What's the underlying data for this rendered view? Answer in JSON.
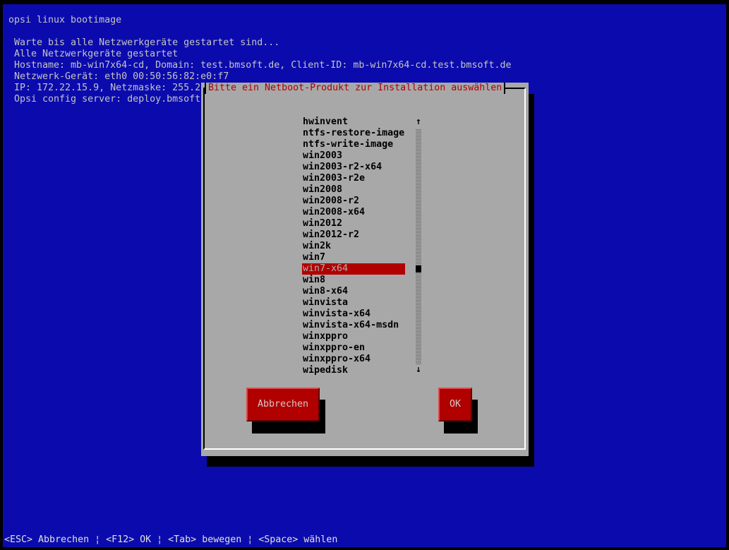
{
  "screen": {
    "title": "opsi linux bootimage",
    "lines": [
      "Warte bis alle Netzwerkgeräte gestartet sind...",
      "Alle Netzwerkgeräte gestartet",
      "Hostname: mb-win7x64-cd, Domain: test.bmsoft.de, Client-ID: mb-win7x64-cd.test.bmsoft.de",
      "Netzwerk-Gerät: eth0 00:50:56:82:e0:f7",
      "IP: 172.22.15.9, Netzmaske: 255.2",
      "Opsi config server: deploy.bmsoft"
    ]
  },
  "dialog": {
    "title": "Bitte ein Netboot-Produkt zur Installation auswählen",
    "items": [
      "hwinvent",
      "ntfs-restore-image",
      "ntfs-write-image",
      "win2003",
      "win2003-r2-x64",
      "win2003-r2e",
      "win2008",
      "win2008-r2",
      "win2008-x64",
      "win2012",
      "win2012-r2",
      "win2k",
      "win7",
      "win7-x64",
      "win8",
      "win8-x64",
      "winvista",
      "winvista-x64",
      "winvista-x64-msdn",
      "winxppro",
      "winxppro-en",
      "winxppro-x64",
      "wipedisk"
    ],
    "selected": "win7-x64",
    "scroll_up": "↑",
    "scroll_down": "↓",
    "cancel_label": "Abbrechen",
    "ok_label": "OK"
  },
  "footer": {
    "hint": "<ESC> Abbrechen ¦ <F12> OK ¦ <Tab> bewegen ¦ <Space> wählen"
  },
  "colors": {
    "background": "#0b0bad",
    "dialog": "#a8a8a8",
    "accent": "#b00000"
  }
}
